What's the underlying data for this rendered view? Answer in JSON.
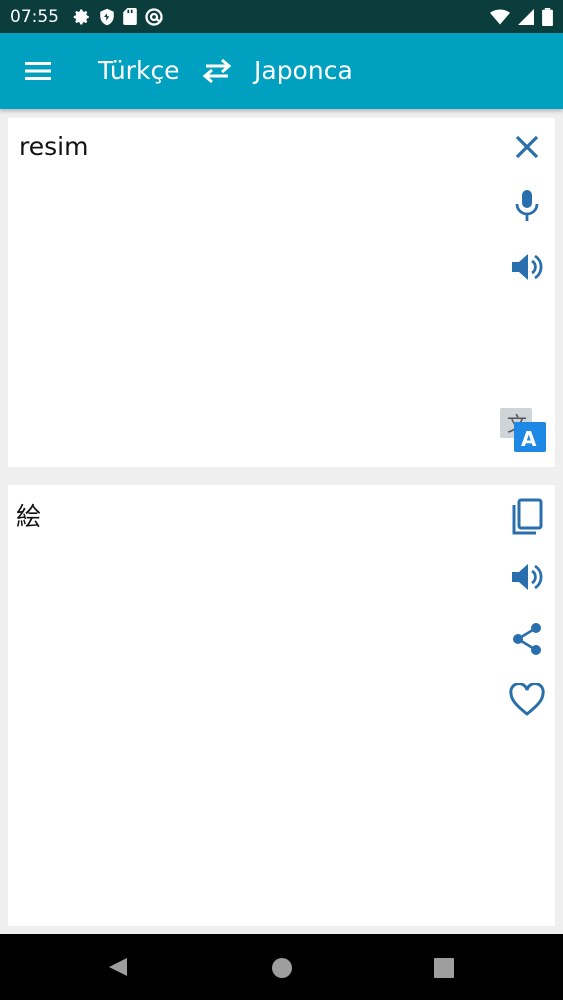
{
  "status_bar": {
    "time": "07:55",
    "left_icons": [
      "gear-icon",
      "shield-icon",
      "sd-card-icon",
      "at-sign-icon"
    ],
    "right_icons": [
      "wifi-icon",
      "signal-icon",
      "battery-icon"
    ]
  },
  "app_bar": {
    "source_language": "Türkçe",
    "target_language": "Japonca",
    "menu_icon": "hamburger-menu-icon",
    "swap_icon": "swap-arrows-icon",
    "background_color": "#00a0c0"
  },
  "input_card": {
    "text": "resim",
    "actions": [
      "close-icon",
      "microphone-icon",
      "speaker-icon",
      "translate-icon"
    ]
  },
  "output_card": {
    "text": "絵",
    "actions": [
      "copy-icon",
      "speaker-icon",
      "share-icon",
      "heart-icon"
    ]
  },
  "colors": {
    "accent_icon": "#2a6fad",
    "status_bar": "#0b3d3d",
    "translate_badge": "#1e88e5"
  },
  "nav_bar": {
    "buttons": [
      "back-icon",
      "home-icon",
      "recents-icon"
    ]
  }
}
